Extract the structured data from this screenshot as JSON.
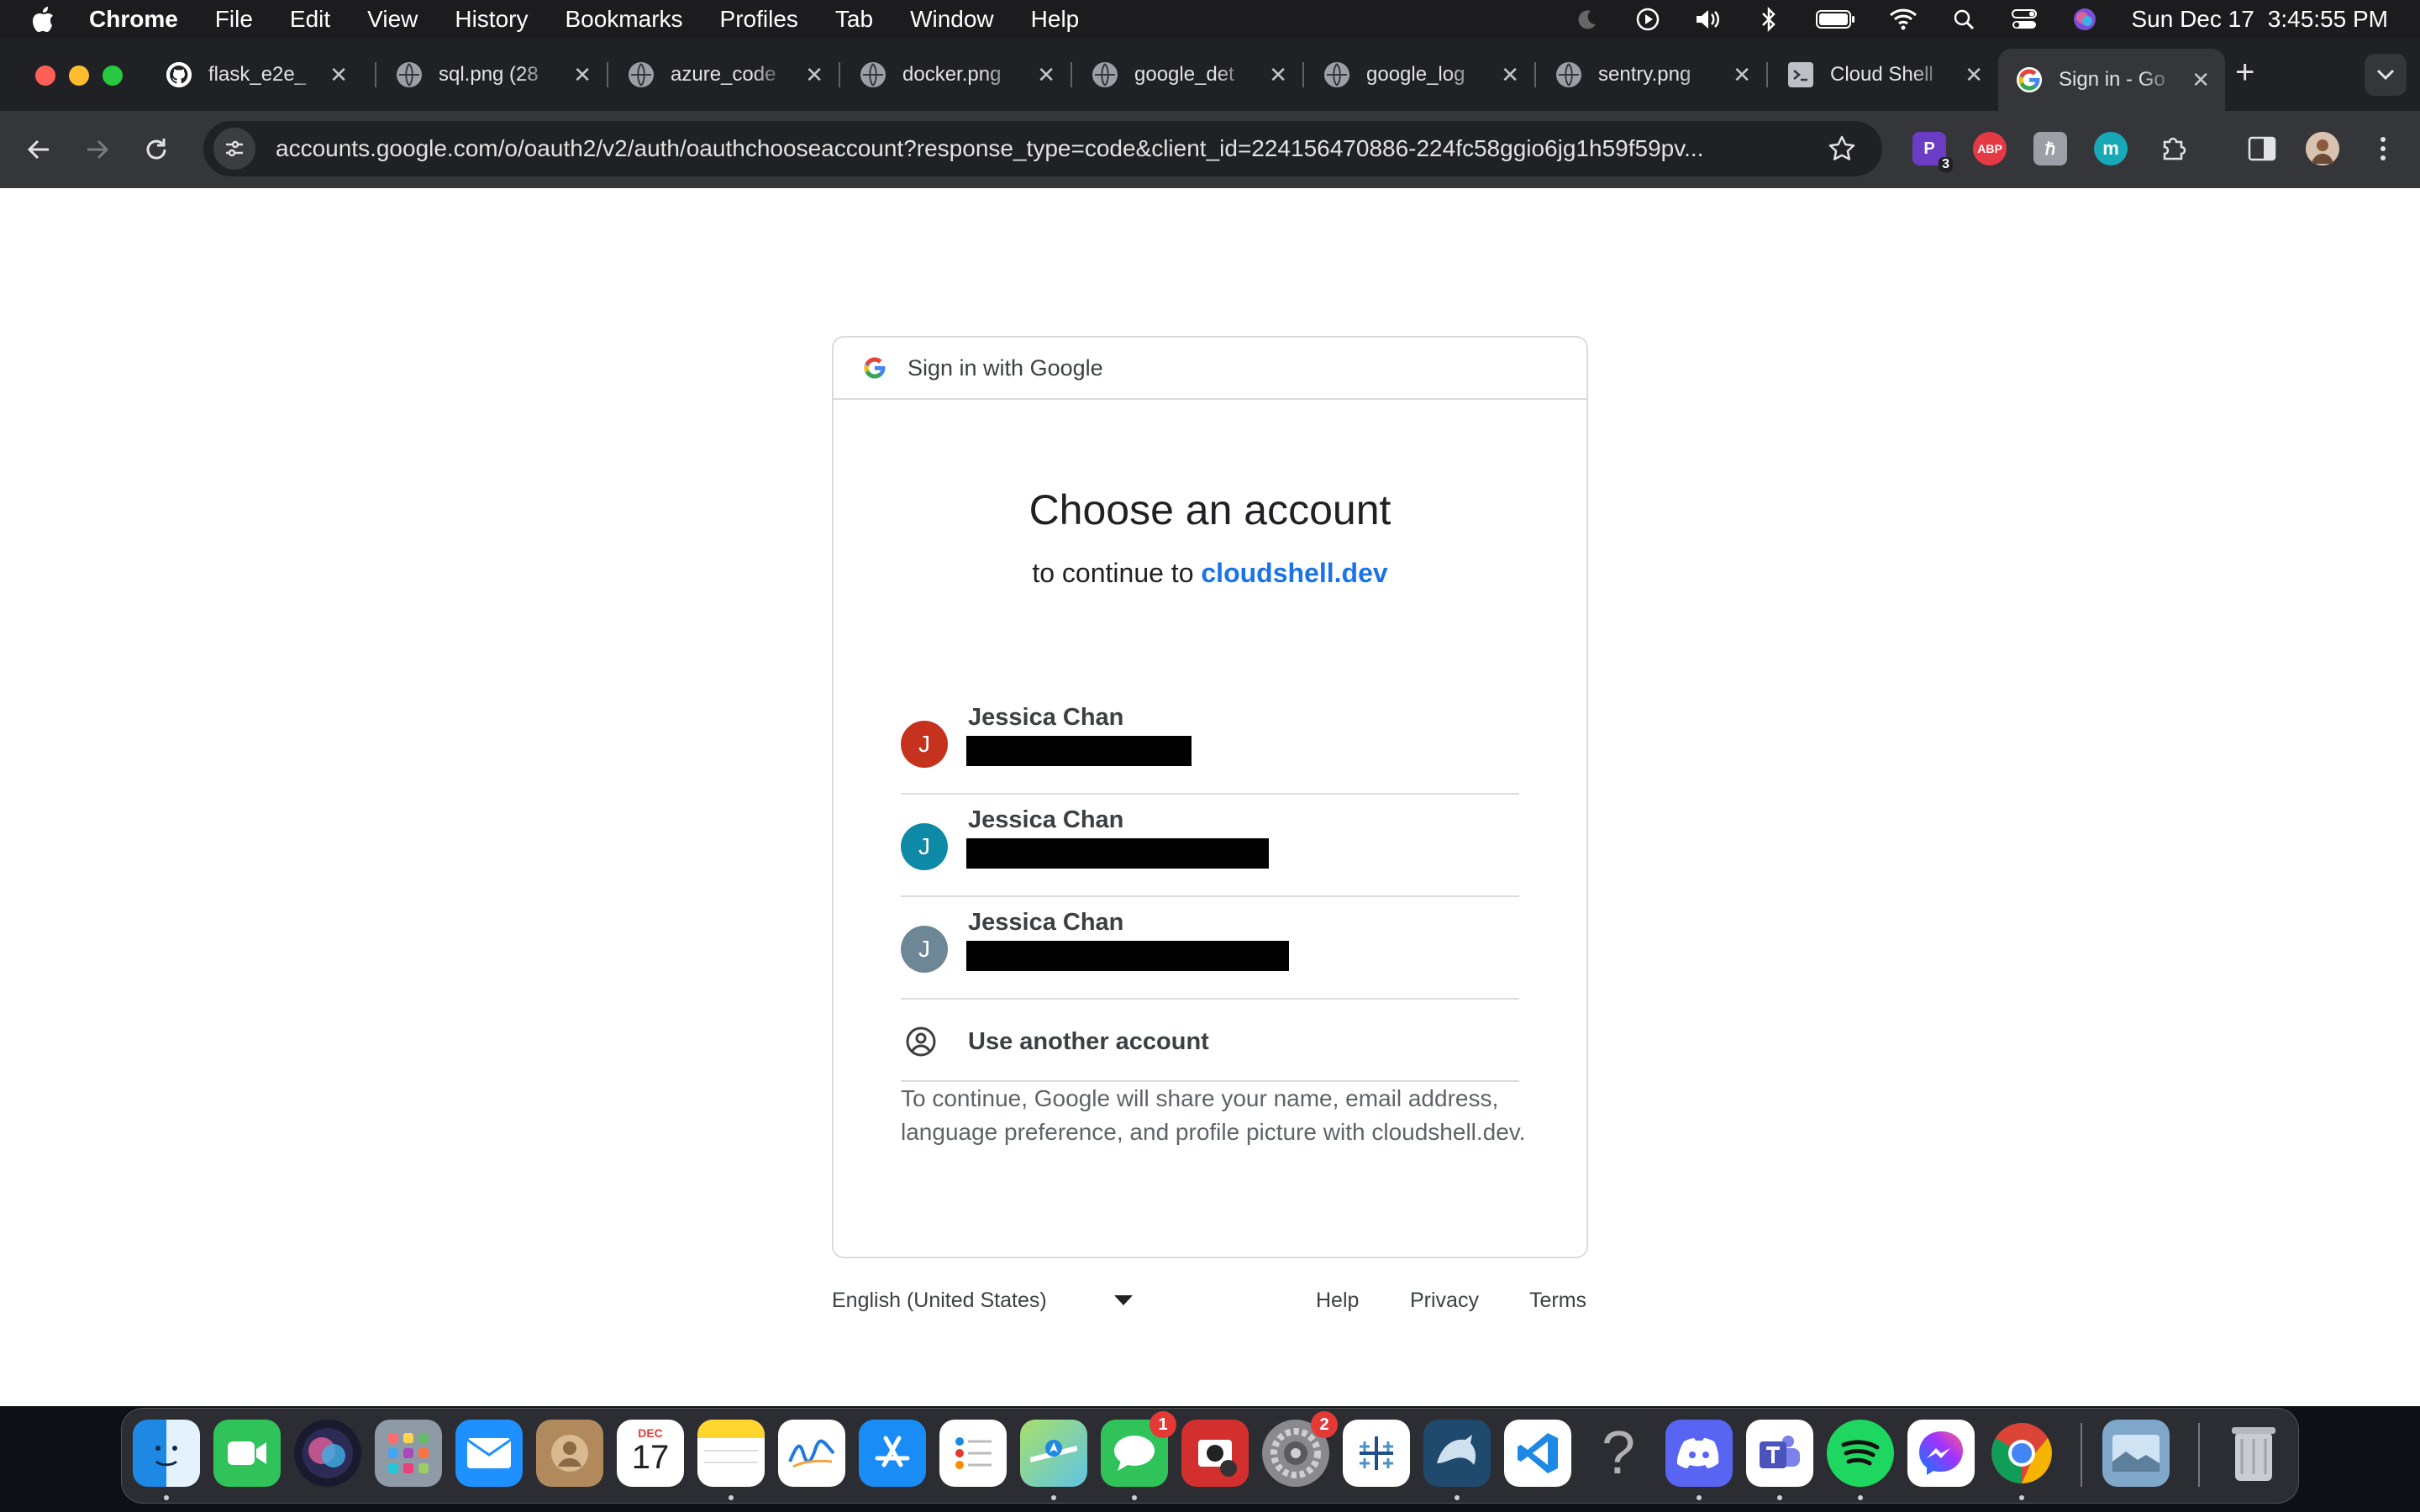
{
  "menubar": {
    "app_name": "Chrome",
    "menus": [
      "File",
      "Edit",
      "View",
      "History",
      "Bookmarks",
      "Profiles",
      "Tab",
      "Window",
      "Help"
    ],
    "date": "Sun Dec 17",
    "time": "3:45:55 PM"
  },
  "tabs": [
    {
      "title": "flask_e2e_"
    },
    {
      "title": "sql.png (28"
    },
    {
      "title": "azure_code"
    },
    {
      "title": "docker.png"
    },
    {
      "title": "google_det"
    },
    {
      "title": "google_log"
    },
    {
      "title": "sentry.png"
    },
    {
      "title": "Cloud Shell"
    },
    {
      "title": "Sign in - Go"
    }
  ],
  "address_bar": {
    "url": "accounts.google.com/o/oauth2/v2/auth/oauthchooseaccount?response_type=code&client_id=224156470886-224fc58ggio6jg1h59f59pv..."
  },
  "extensions": {
    "badge_count": "3",
    "abp_label": "ABP",
    "m_label": "m"
  },
  "signin": {
    "header": "Sign in with Google",
    "heading": "Choose an account",
    "continue_prefix": "to continue to",
    "continue_link": "cloudshell.dev",
    "accounts": [
      {
        "initial": "J",
        "name": "Jessica Chan",
        "color": "#c5321d"
      },
      {
        "initial": "J",
        "name": "Jessica Chan",
        "color": "#0f8aa6"
      },
      {
        "initial": "J",
        "name": "Jessica Chan",
        "color": "#6e8796"
      }
    ],
    "use_another": "Use another account",
    "disclaimer": "To continue, Google will share your name, email address, language preference, and profile picture with cloudshell.dev."
  },
  "footer": {
    "language": "English (United States)",
    "help": "Help",
    "privacy": "Privacy",
    "terms": "Terms"
  },
  "dock": {
    "calendar_month": "DEC",
    "calendar_day": "17",
    "messages_badge": "1",
    "settings_badge": "2"
  }
}
